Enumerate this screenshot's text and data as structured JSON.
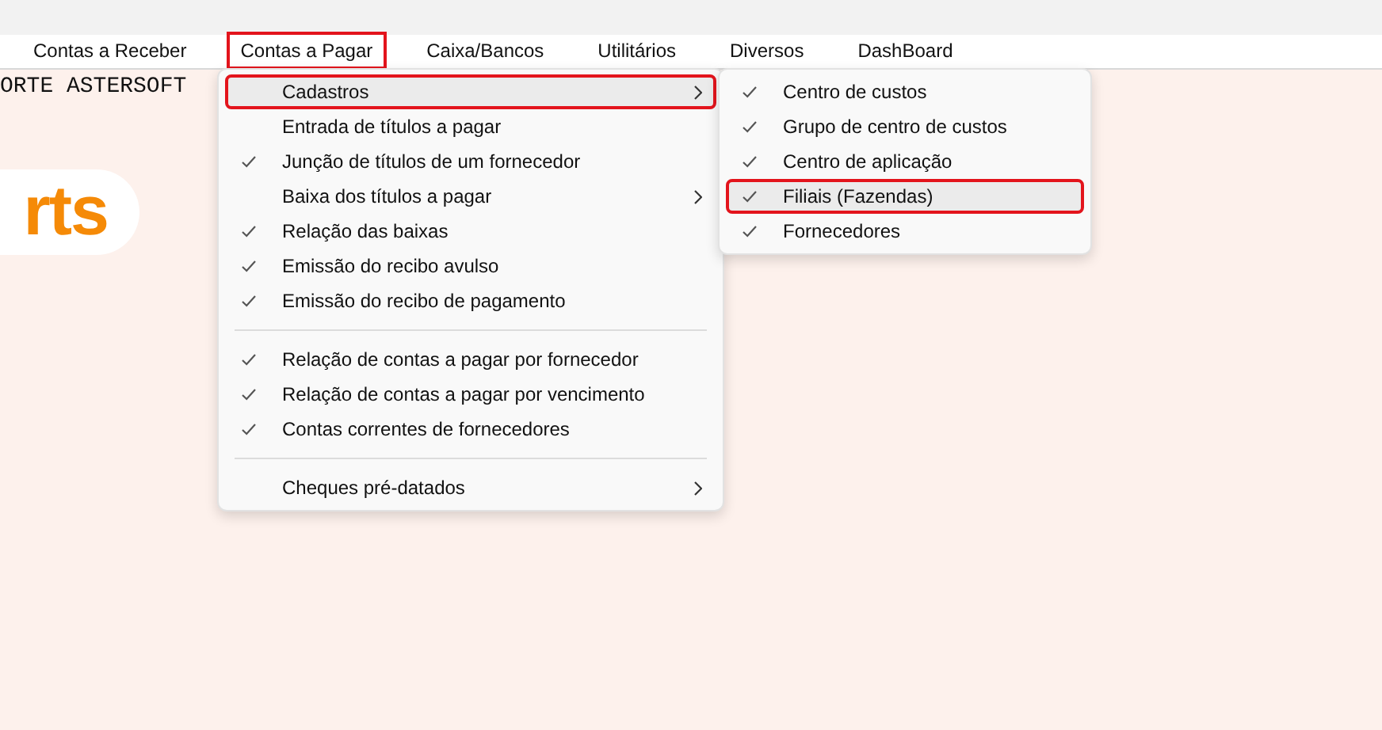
{
  "menu_bar": [
    {
      "label": "Contas a Receber",
      "selected": false,
      "annotated": false
    },
    {
      "label": "Contas a Pagar",
      "selected": false,
      "annotated": true
    },
    {
      "label": "Caixa/Bancos",
      "selected": false,
      "annotated": false
    },
    {
      "label": "Utilitários",
      "selected": false,
      "annotated": false
    },
    {
      "label": "Diversos",
      "selected": false,
      "annotated": false
    },
    {
      "label": "DashBoard",
      "selected": false,
      "annotated": false
    }
  ],
  "background": {
    "banner_text": "ORTE ASTERSOFT",
    "logo_text": "rts"
  },
  "menu": {
    "groups": [
      [
        {
          "label": "Cadastros",
          "checked": false,
          "submenu": true,
          "selected": true,
          "annotated": true
        },
        {
          "label": "Entrada de títulos a pagar",
          "checked": false,
          "submenu": false,
          "selected": false,
          "annotated": false
        },
        {
          "label": "Junção de títulos de um fornecedor",
          "checked": true,
          "submenu": false,
          "selected": false,
          "annotated": false
        },
        {
          "label": "Baixa dos títulos a pagar",
          "checked": false,
          "submenu": true,
          "selected": false,
          "annotated": false
        },
        {
          "label": "Relação das baixas",
          "checked": true,
          "submenu": false,
          "selected": false,
          "annotated": false
        },
        {
          "label": "Emissão do recibo avulso",
          "checked": true,
          "submenu": false,
          "selected": false,
          "annotated": false
        },
        {
          "label": "Emissão do recibo de pagamento",
          "checked": true,
          "submenu": false,
          "selected": false,
          "annotated": false
        }
      ],
      [
        {
          "label": "Relação de contas a pagar por fornecedor",
          "checked": true,
          "submenu": false,
          "selected": false,
          "annotated": false
        },
        {
          "label": "Relação de contas a pagar por vencimento",
          "checked": true,
          "submenu": false,
          "selected": false,
          "annotated": false
        },
        {
          "label": "Contas correntes de fornecedores",
          "checked": true,
          "submenu": false,
          "selected": false,
          "annotated": false
        }
      ],
      [
        {
          "label": "Cheques pré-datados",
          "checked": false,
          "submenu": true,
          "selected": false,
          "annotated": false
        }
      ]
    ]
  },
  "submenu": {
    "items": [
      {
        "label": "Centro de custos",
        "checked": true,
        "selected": false,
        "annotated": false
      },
      {
        "label": "Grupo de centro de custos",
        "checked": true,
        "selected": false,
        "annotated": false
      },
      {
        "label": "Centro de aplicação",
        "checked": true,
        "selected": false,
        "annotated": false
      },
      {
        "label": "Filiais (Fazendas)",
        "checked": true,
        "selected": true,
        "annotated": true
      },
      {
        "label": "Fornecedores",
        "checked": true,
        "selected": false,
        "annotated": false
      }
    ]
  }
}
